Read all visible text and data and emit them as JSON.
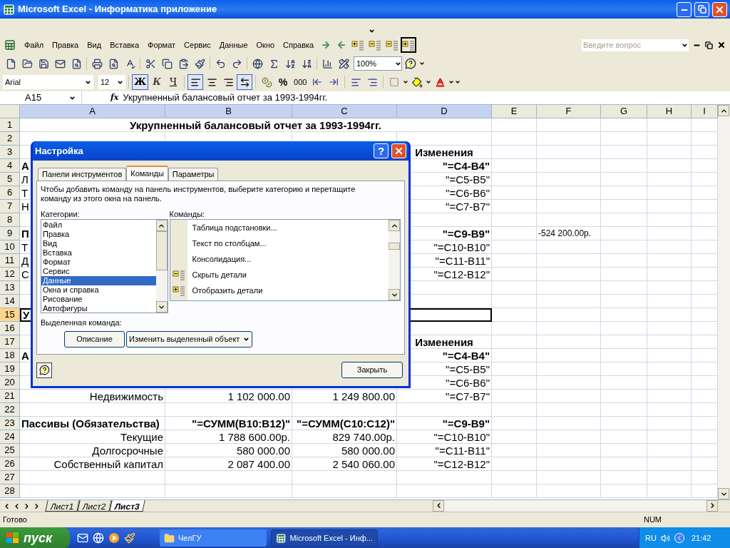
{
  "window": {
    "title": "Microsoft Excel - Информатика приложение"
  },
  "menu": [
    "Файл",
    "Правка",
    "Вид",
    "Вставка",
    "Формат",
    "Сервис",
    "Данные",
    "Окно",
    "Справка"
  ],
  "help_search": {
    "placeholder": "Введите вопрос"
  },
  "standard_toolbar": {
    "zoom": "100%"
  },
  "formatting_toolbar": {
    "font": "Arial",
    "size": "12",
    "style_buttons": [
      {
        "label": "Ж",
        "kind": "bold",
        "pressed": true
      },
      {
        "label": "К",
        "kind": "italic",
        "pressed": false
      },
      {
        "label": "Ч",
        "kind": "underline",
        "pressed": false
      }
    ],
    "align_buttons": [
      {
        "kind": "left",
        "pressed": true
      },
      {
        "kind": "center",
        "pressed": false
      },
      {
        "kind": "right",
        "pressed": false
      },
      {
        "kind": "merge",
        "pressed": true
      }
    ],
    "percent": "%",
    "thousands": "000"
  },
  "formula_bar": {
    "name_box": "A15",
    "fx": "fx",
    "formula": "Укрупненный балансовый отчет за 1993-1994гг."
  },
  "sheet": {
    "columns": [
      {
        "label": "A",
        "selected": true
      },
      {
        "label": "B",
        "selected": true
      },
      {
        "label": "C",
        "selected": true
      },
      {
        "label": "D",
        "selected": true
      },
      {
        "label": "E",
        "selected": false
      },
      {
        "label": "F",
        "selected": false
      },
      {
        "label": "G",
        "selected": false
      },
      {
        "label": "H",
        "selected": false
      },
      {
        "label": "I",
        "selected": false
      }
    ],
    "rows": [
      {
        "label": "1",
        "selected": false,
        "a": {
          "kind": "title",
          "text": "Укрупненный балансовый отчет за 1993-1994гг."
        }
      },
      {
        "label": "2",
        "selected": false
      },
      {
        "label": "3",
        "selected": false,
        "d": {
          "kind": "column_heading",
          "text": "Изменения"
        }
      },
      {
        "label": "4",
        "selected": false,
        "a": {
          "kind": "heading",
          "text": "А"
        },
        "d": {
          "kind": "total",
          "text": "\"=C4-B4\""
        }
      },
      {
        "label": "5",
        "selected": false,
        "a": {
          "kind": "text",
          "text": "Л"
        },
        "d": {
          "kind": "value",
          "text": "\"=C5-B5\""
        }
      },
      {
        "label": "6",
        "selected": false,
        "a": {
          "kind": "text",
          "text": "Т"
        },
        "d": {
          "kind": "value",
          "text": "\"=C6-B6\""
        }
      },
      {
        "label": "7",
        "selected": false,
        "a": {
          "kind": "text",
          "text": "Н"
        },
        "d": {
          "kind": "value",
          "text": "\"=C7-B7\""
        }
      },
      {
        "label": "8",
        "selected": false
      },
      {
        "label": "9",
        "selected": false,
        "a": {
          "kind": "heading",
          "text": "П"
        },
        "d": {
          "kind": "total",
          "text": "\"=C9-B9\""
        },
        "f": {
          "kind": "note",
          "text": "-524 200.00р."
        }
      },
      {
        "label": "10",
        "selected": false,
        "a": {
          "kind": "text",
          "text": "Т"
        },
        "d": {
          "kind": "value",
          "text": "\"=C10-B10\""
        }
      },
      {
        "label": "11",
        "selected": false,
        "a": {
          "kind": "text",
          "text": "Д"
        },
        "d": {
          "kind": "value",
          "text": "\"=C11-B11\""
        }
      },
      {
        "label": "12",
        "selected": false,
        "a": {
          "kind": "text",
          "text": "С"
        },
        "d": {
          "kind": "value",
          "text": "\"=C12-B12\""
        }
      },
      {
        "label": "13",
        "selected": false
      },
      {
        "label": "14",
        "selected": false
      },
      {
        "label": "15",
        "selected": true,
        "a": {
          "kind": "merged",
          "text": "У"
        }
      },
      {
        "label": "16",
        "selected": false
      },
      {
        "label": "17",
        "selected": false,
        "d": {
          "kind": "column_heading",
          "text": "Изменения"
        }
      },
      {
        "label": "18",
        "selected": false,
        "a": {
          "kind": "heading",
          "text": "А"
        },
        "d": {
          "kind": "total",
          "text": "\"=C4-B4\""
        }
      },
      {
        "label": "19",
        "selected": false,
        "d": {
          "kind": "value",
          "text": "\"=C5-B5\""
        }
      },
      {
        "label": "20",
        "selected": false,
        "d": {
          "kind": "value",
          "text": "\"=C6-B6\""
        }
      },
      {
        "label": "21",
        "selected": false,
        "a": {
          "kind": "value",
          "text": "Недвижимость"
        },
        "b": {
          "kind": "value",
          "text": "1 102 000.00"
        },
        "c": {
          "kind": "value",
          "text": "1 249 800.00"
        },
        "d": {
          "kind": "value",
          "text": "\"=C7-B7\""
        }
      },
      {
        "label": "22",
        "selected": false
      },
      {
        "label": "23",
        "selected": false,
        "a": {
          "kind": "heading",
          "text": "Пассивы (Обязательства)"
        },
        "b": {
          "kind": "total",
          "text": "\"=СУММ(B10:B12)\""
        },
        "c": {
          "kind": "total",
          "text": "\"=СУММ(C10:C12)\""
        },
        "d": {
          "kind": "total",
          "text": "\"=C9-B9\""
        }
      },
      {
        "label": "24",
        "selected": false,
        "a": {
          "kind": "value",
          "text": "Текущие"
        },
        "b": {
          "kind": "value",
          "text": "1 788 600.00р."
        },
        "c": {
          "kind": "value",
          "text": "829 740.00р."
        },
        "d": {
          "kind": "value",
          "text": "\"=C10-B10\""
        }
      },
      {
        "label": "25",
        "selected": false,
        "a": {
          "kind": "value",
          "text": "Долгосрочные"
        },
        "b": {
          "kind": "value",
          "text": "580 000.00"
        },
        "c": {
          "kind": "value",
          "text": "580 000.00"
        },
        "d": {
          "kind": "value",
          "text": "\"=C11-B11\""
        }
      },
      {
        "label": "26",
        "selected": false,
        "a": {
          "kind": "value",
          "text": "Собственный капитал"
        },
        "b": {
          "kind": "value",
          "text": "2 087 400.00"
        },
        "c": {
          "kind": "value",
          "text": "2 540 060.00"
        },
        "d": {
          "kind": "value",
          "text": "\"=C12-B12\""
        }
      },
      {
        "label": "27",
        "selected": false
      },
      {
        "label": "28",
        "selected": false
      }
    ]
  },
  "dialog": {
    "title": "Настройка",
    "help_button": "?",
    "tabs": [
      {
        "label": "Панели инструментов",
        "selected": false
      },
      {
        "label": "Команды",
        "selected": true
      },
      {
        "label": "Параметры",
        "selected": false
      }
    ],
    "instructions": "Чтобы добавить команду на панель инструментов, выберите категорию и перетащите команду из этого окна на панель.",
    "categories_label": "Категории:",
    "categories": [
      {
        "label": "Файл",
        "selected": false
      },
      {
        "label": "Правка",
        "selected": false
      },
      {
        "label": "Вид",
        "selected": false
      },
      {
        "label": "Вставка",
        "selected": false
      },
      {
        "label": "Формат",
        "selected": false
      },
      {
        "label": "Сервис",
        "selected": false
      },
      {
        "label": "Данные",
        "selected": true
      },
      {
        "label": "Окна и справка",
        "selected": false
      },
      {
        "label": "Рисование",
        "selected": false
      },
      {
        "label": "Автофигуры",
        "selected": false
      }
    ],
    "commands_label": "Команды:",
    "commands": [
      {
        "label": "Таблица подстановки...",
        "kind": "plain"
      },
      {
        "label": "Текст по столбцам...",
        "kind": "plain"
      },
      {
        "label": "Консолидация...",
        "kind": "plain"
      },
      {
        "label": "Скрыть детали",
        "kind": "collapse"
      },
      {
        "label": "Отобразить детали",
        "kind": "expand"
      }
    ],
    "selected_command_label": "Выделенная команда:",
    "describe_button": "Описание",
    "modify_button": "Изменить выделенный объект",
    "close_button": "Закрыть"
  },
  "sheet_tabs": [
    {
      "label": "Лист1",
      "selected": false
    },
    {
      "label": "Лист2",
      "selected": false
    },
    {
      "label": "Лист3",
      "selected": true
    }
  ],
  "status_bar": {
    "text": "Готово",
    "indicator": "NUM"
  },
  "taskbar": {
    "start": "пуск",
    "tasks": [
      {
        "label": "ЧелГУ",
        "kind": "folder",
        "selected": false
      },
      {
        "label": "Microsoft Excel - Инф...",
        "kind": "excel",
        "selected": true
      }
    ],
    "language": "RU",
    "clock": "21:42"
  }
}
